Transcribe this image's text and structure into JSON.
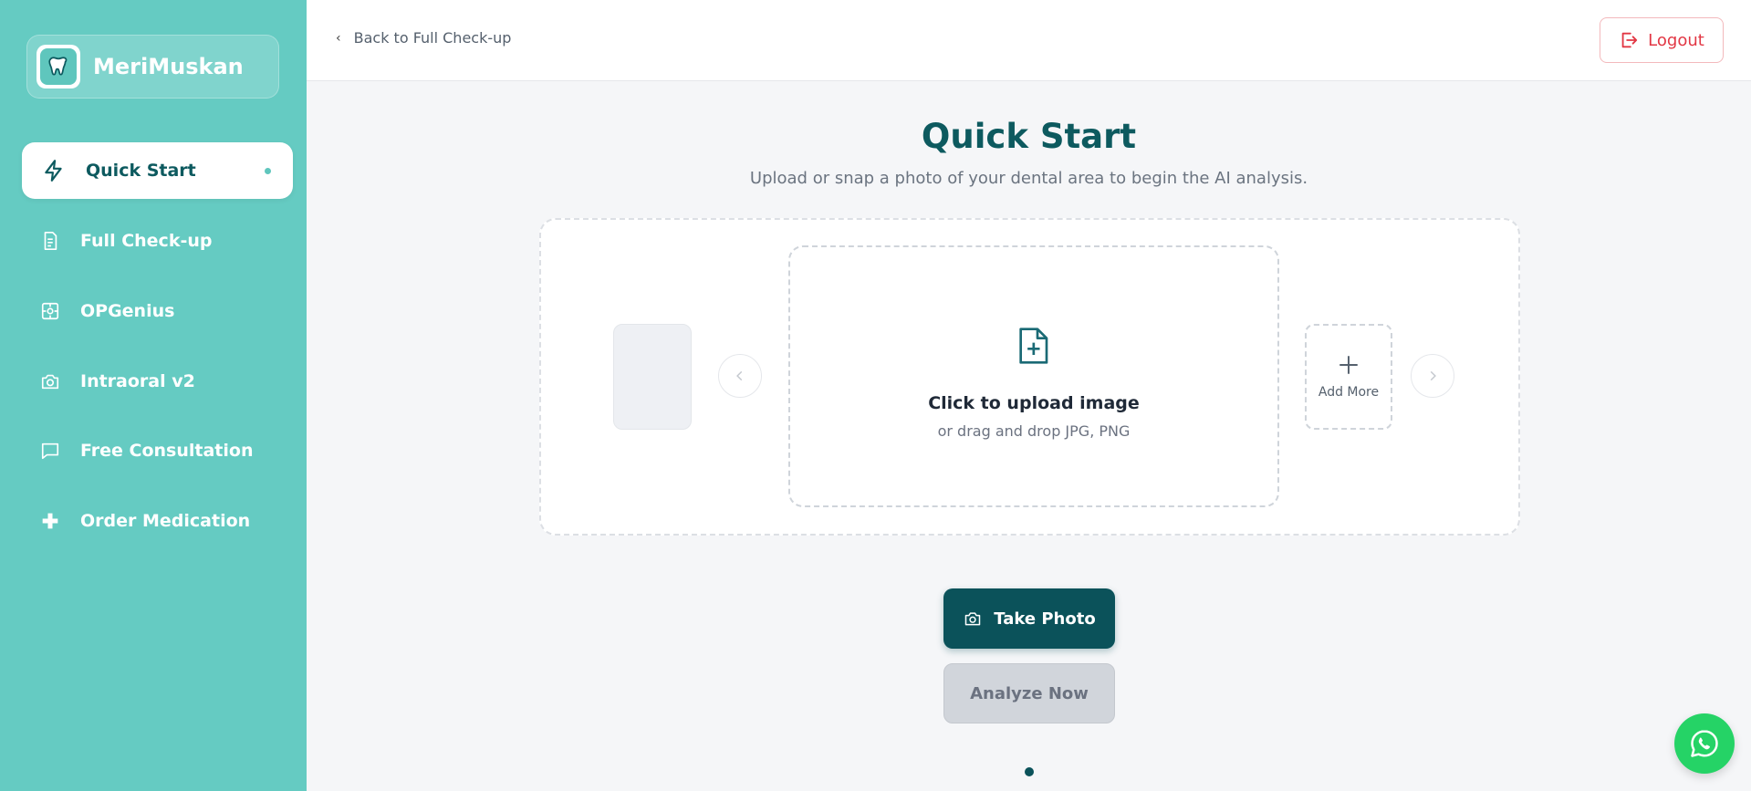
{
  "app": {
    "name": "MeriMuskan"
  },
  "sidebar": {
    "items": [
      {
        "label": "Quick Start",
        "icon": "lightning-icon",
        "active": true
      },
      {
        "label": "Full Check-up",
        "icon": "document-icon"
      },
      {
        "label": "OPGenius",
        "icon": "scan-icon"
      },
      {
        "label": "Intraoral v2",
        "icon": "camera-icon"
      },
      {
        "label": "Free Consultation",
        "icon": "chat-icon"
      },
      {
        "label": "Order Medication",
        "icon": "medical-cross-icon"
      }
    ]
  },
  "header": {
    "back_label": "Back to Full Check-up",
    "logout_label": "Logout"
  },
  "main": {
    "title": "Quick Start",
    "subtitle": "Upload or snap a photo of your dental area to begin the AI analysis.",
    "upload": {
      "title": "Click to upload image",
      "hint": "or drag and drop JPG, PNG"
    },
    "add_more_label": "Add More",
    "take_photo_label": "Take Photo",
    "analyze_label": "Analyze Now"
  },
  "colors": {
    "sidebar": "#65cbc2",
    "primary": "#0b525a",
    "title": "#0d5a5f",
    "logout": "#e23744",
    "whatsapp": "#25d366"
  }
}
